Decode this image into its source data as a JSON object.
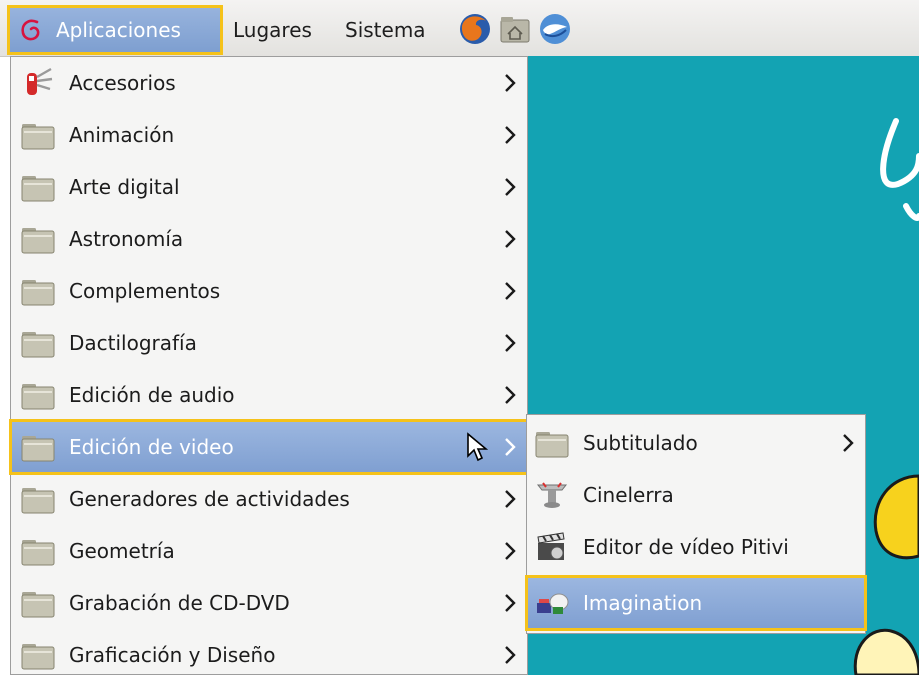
{
  "panel": {
    "menus": {
      "applications": "Aplicaciones",
      "places": "Lugares",
      "system": "Sistema"
    },
    "launchers": [
      "firefox-icon",
      "home-folder-icon",
      "thunderbird-icon"
    ]
  },
  "main_menu": {
    "items": [
      {
        "label": "Accesorios"
      },
      {
        "label": "Animación"
      },
      {
        "label": "Arte digital"
      },
      {
        "label": "Astronomía"
      },
      {
        "label": "Complementos"
      },
      {
        "label": "Dactilografía"
      },
      {
        "label": "Edición de audio"
      },
      {
        "label": "Edición de video"
      },
      {
        "label": "Generadores de actividades"
      },
      {
        "label": "Geometría"
      },
      {
        "label": "Grabación de CD-DVD"
      },
      {
        "label": "Graficación y Diseño"
      }
    ]
  },
  "submenu": {
    "items": [
      {
        "label": "Subtitulado"
      },
      {
        "label": "Cinelerra"
      },
      {
        "label": "Editor de vídeo Pitivi"
      },
      {
        "label": "Imagination"
      }
    ]
  },
  "colors": {
    "highlight": "#f5c21a",
    "selection": "#8aa8d6",
    "desktop": "#13a3b3"
  }
}
